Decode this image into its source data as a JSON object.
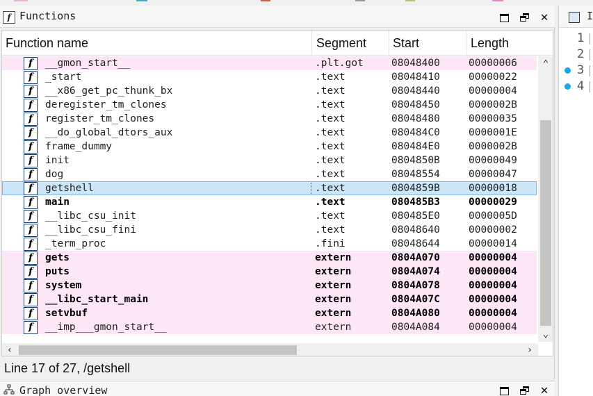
{
  "functions_window": {
    "title": "Functions",
    "columns": {
      "name": "Function name",
      "segment": "Segment",
      "start": "Start",
      "length": "Length"
    },
    "rows": [
      {
        "name": "__gmon_start__",
        "segment": ".plt.got",
        "start": "08048400",
        "length": "00000006",
        "style": "pink"
      },
      {
        "name": "_start",
        "segment": ".text",
        "start": "08048410",
        "length": "00000022",
        "style": "normal"
      },
      {
        "name": "__x86_get_pc_thunk_bx",
        "segment": ".text",
        "start": "08048440",
        "length": "00000004",
        "style": "normal"
      },
      {
        "name": "deregister_tm_clones",
        "segment": ".text",
        "start": "08048450",
        "length": "0000002B",
        "style": "normal"
      },
      {
        "name": "register_tm_clones",
        "segment": ".text",
        "start": "08048480",
        "length": "00000035",
        "style": "normal"
      },
      {
        "name": "__do_global_dtors_aux",
        "segment": ".text",
        "start": "080484C0",
        "length": "0000001E",
        "style": "normal"
      },
      {
        "name": "frame_dummy",
        "segment": ".text",
        "start": "080484E0",
        "length": "0000002B",
        "style": "normal"
      },
      {
        "name": "init",
        "segment": ".text",
        "start": "0804850B",
        "length": "00000049",
        "style": "normal"
      },
      {
        "name": "dog",
        "segment": ".text",
        "start": "08048554",
        "length": "00000047",
        "style": "normal"
      },
      {
        "name": "getshell",
        "segment": ".text",
        "start": "0804859B",
        "length": "00000018",
        "style": "selected"
      },
      {
        "name": "main",
        "segment": ".text",
        "start": "080485B3",
        "length": "00000029",
        "style": "bold"
      },
      {
        "name": "__libc_csu_init",
        "segment": ".text",
        "start": "080485E0",
        "length": "0000005D",
        "style": "normal"
      },
      {
        "name": "__libc_csu_fini",
        "segment": ".text",
        "start": "08048640",
        "length": "00000002",
        "style": "normal"
      },
      {
        "name": "_term_proc",
        "segment": ".fini",
        "start": "08048644",
        "length": "00000014",
        "style": "normal"
      },
      {
        "name": "gets",
        "segment": "extern",
        "start": "0804A070",
        "length": "00000004",
        "style": "pink-bold"
      },
      {
        "name": "puts",
        "segment": "extern",
        "start": "0804A074",
        "length": "00000004",
        "style": "pink-bold"
      },
      {
        "name": "system",
        "segment": "extern",
        "start": "0804A078",
        "length": "00000004",
        "style": "pink-bold"
      },
      {
        "name": "__libc_start_main",
        "segment": "extern",
        "start": "0804A07C",
        "length": "00000004",
        "style": "pink-bold"
      },
      {
        "name": "setvbuf",
        "segment": "extern",
        "start": "0804A080",
        "length": "00000004",
        "style": "pink-bold"
      },
      {
        "name": "__imp___gmon_start__",
        "segment": "extern",
        "start": "0804A084",
        "length": "00000004",
        "style": "pink"
      }
    ],
    "status": "Line 17 of 27, /getshell"
  },
  "graph_overview": {
    "title": "Graph overview"
  },
  "right_panel": {
    "title": "I",
    "line_numbers": [
      "1",
      "2",
      "3",
      "4"
    ],
    "breakpoint_lines": [
      3,
      4
    ]
  },
  "icons": {
    "function": "function-icon",
    "panel": "functions-window-icon",
    "graph": "graph-overview-icon",
    "maximize": "maximize-icon",
    "restore": "restore-icon",
    "close": "close-icon"
  },
  "colors": {
    "row_pink": "#fde6f6",
    "row_selected": "#cce6f9",
    "breakpoint": "#1aa8e8"
  }
}
